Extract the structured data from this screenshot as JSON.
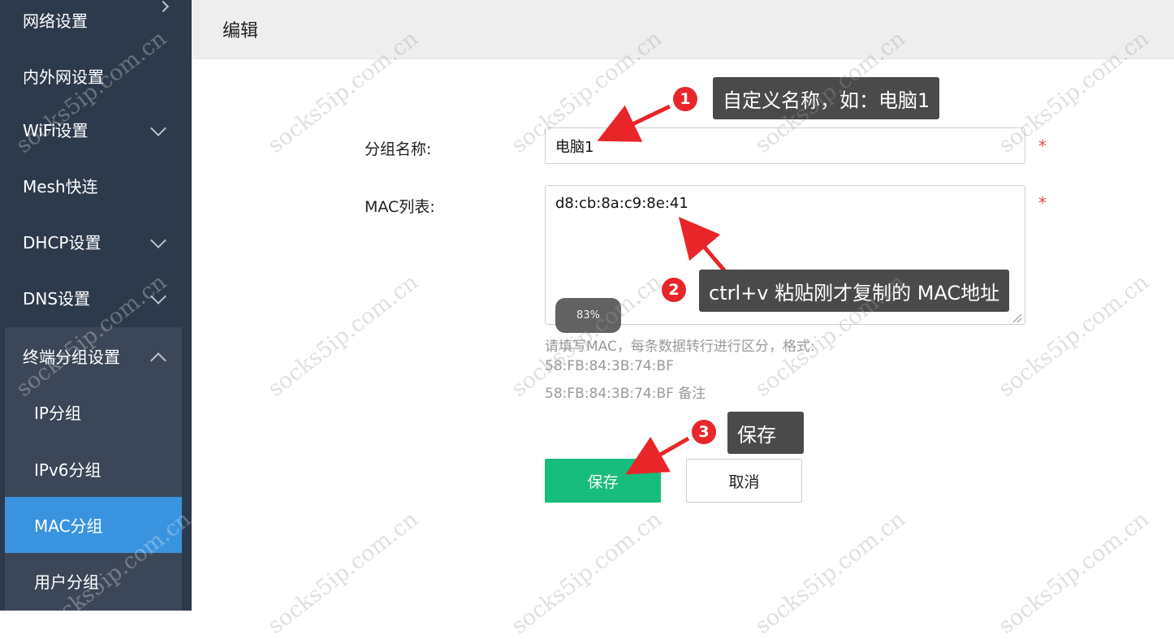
{
  "sidebar": {
    "items": [
      {
        "label": "网络设置"
      },
      {
        "label": "内外网设置"
      },
      {
        "label": "WiFi设置"
      },
      {
        "label": "Mesh快连"
      },
      {
        "label": "DHCP设置"
      },
      {
        "label": "DNS设置"
      },
      {
        "label": "终端分组设置"
      }
    ],
    "sub_items": [
      {
        "label": "IP分组"
      },
      {
        "label": "IPv6分组"
      },
      {
        "label": "MAC分组",
        "active": true
      },
      {
        "label": "用户分组"
      }
    ],
    "active_color": "#3a93de",
    "bg_color": "#2d3a4c"
  },
  "header": {
    "title": "编辑"
  },
  "form": {
    "group_name_label": "分组名称:",
    "group_name_value": "电脑1",
    "mac_list_label": "MAC列表:",
    "mac_list_value": "d8:cb:8a:c9:8e:41",
    "required_mark": "*",
    "hint_lines": [
      "请填写MAC，每条数据转行进行区分，格式:",
      "58:FB:84:3B:74:BF",
      "58:FB:84:3B:74:BF 备注"
    ],
    "save_label": "保存",
    "cancel_label": "取消",
    "save_color": "#17bd7c"
  },
  "annotations": [
    {
      "number": "1",
      "text": "自定义名称，如：电脑1"
    },
    {
      "number": "2",
      "text": "ctrl+v 粘贴刚才复制的 MAC地址"
    },
    {
      "number": "3",
      "text": "保存"
    }
  ],
  "zoom_indicator": "83%",
  "watermark": "socks5ip.com.cn"
}
